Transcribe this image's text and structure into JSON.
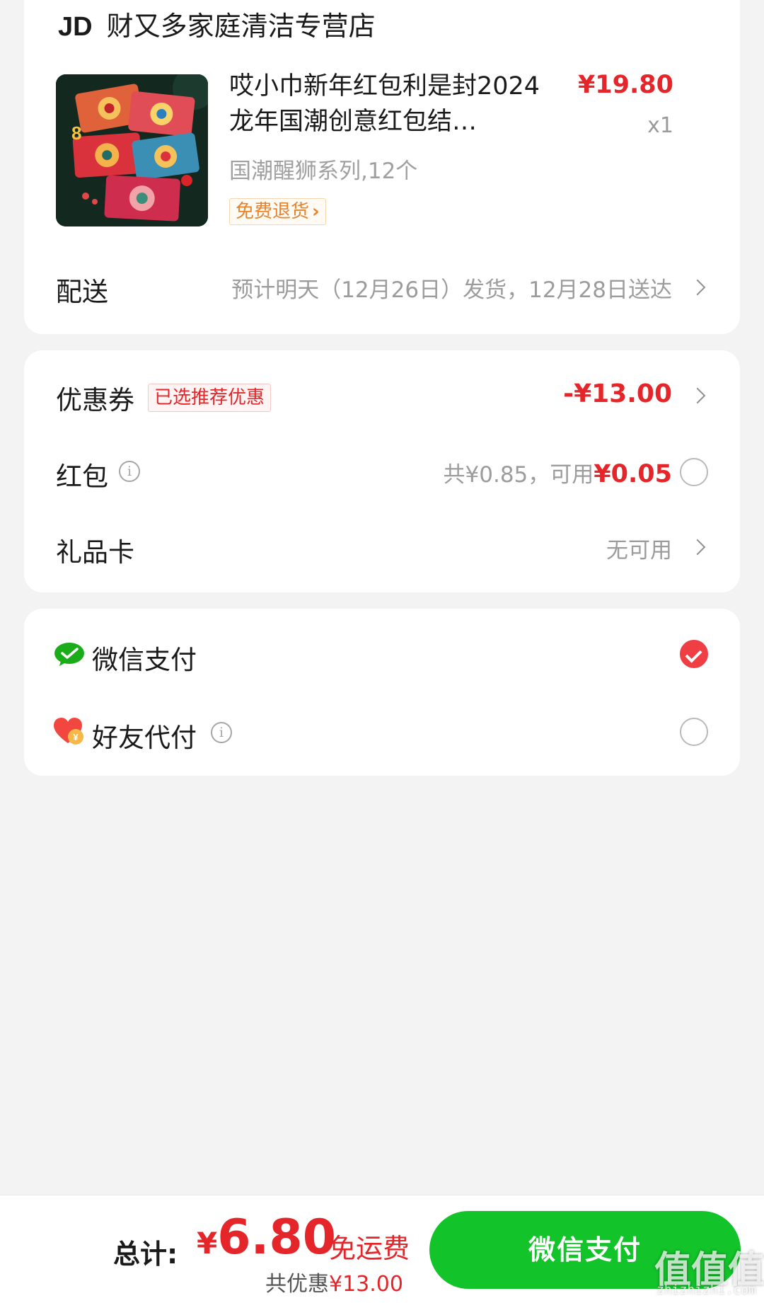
{
  "order": {
    "store_logo": "JD",
    "store_name": "财又多家庭清洁专营店",
    "product": {
      "title": "哎小巾新年红包利是封2024龙年国潮创意红包结婚压岁包千元百元",
      "title_visible": "哎小巾新年红包利是封2024龙年国潮创意红包结…",
      "price": "¥19.80",
      "quantity": "x1",
      "variant": "国潮醒狮系列,12个",
      "return_badge": "免费退货",
      "image_icon": "red-envelope-product-image"
    },
    "delivery": {
      "label": "配送",
      "value": "预计明天（12月26日）发货，12月28日送达"
    }
  },
  "discounts": {
    "coupon": {
      "label": "优惠券",
      "tag": "已选推荐优惠",
      "value": "-¥13.00"
    },
    "red_packet": {
      "label": "红包",
      "total_text": "共¥0.85，可用",
      "usable": "¥0.05"
    },
    "gift_card": {
      "label": "礼品卡",
      "value": "无可用"
    }
  },
  "payment": {
    "wechat": {
      "label": "微信支付",
      "icon": "wechat-pay-icon",
      "selected": true
    },
    "friend": {
      "label": "好友代付",
      "icon": "friend-pay-heart-icon",
      "selected": false
    }
  },
  "footer": {
    "total_label": "总计:",
    "currency": "¥",
    "total_amount": "6.80",
    "free_shipping": "免运费",
    "saved_label": "共优惠",
    "saved_amount": "¥13.00",
    "pay_button": "微信支付"
  },
  "watermark": {
    "text": "值值值",
    "sub": "zhizhizhi.com"
  },
  "colors": {
    "accent_red": "#e4262a",
    "wechat_green": "#12c32a",
    "background": "#f3f3f3",
    "badge_orange": "#e7832c"
  }
}
